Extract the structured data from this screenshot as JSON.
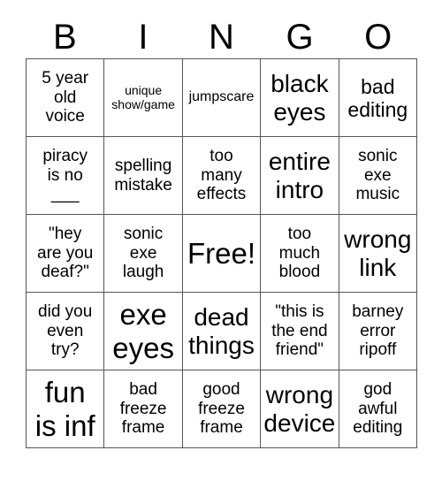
{
  "card": {
    "title": "BINGO",
    "headers": [
      "B",
      "I",
      "N",
      "G",
      "O"
    ],
    "free_space_label": "Free!",
    "colors": {
      "background": "#ffffff",
      "text": "#000000",
      "border": "#555555"
    },
    "rows": [
      [
        {
          "text": "5 year\nold\nvoice",
          "size": "m"
        },
        {
          "text": "unique\nshow/game",
          "size": "xs"
        },
        {
          "text": "jumpscare",
          "size": "s"
        },
        {
          "text": "black\neyes",
          "size": "xl"
        },
        {
          "text": "bad\nediting",
          "size": "l"
        }
      ],
      [
        {
          "text": "piracy\nis no\n___",
          "size": "m"
        },
        {
          "text": "spelling\nmistake",
          "size": "m"
        },
        {
          "text": "too\nmany\neffects",
          "size": "m"
        },
        {
          "text": "entire\nintro",
          "size": "xl"
        },
        {
          "text": "sonic\nexe\nmusic",
          "size": "m"
        }
      ],
      [
        {
          "text": "\"hey\nare you\ndeaf?\"",
          "size": "m"
        },
        {
          "text": "sonic\nexe\nlaugh",
          "size": "m"
        },
        {
          "text": "Free!",
          "size": "xxl"
        },
        {
          "text": "too\nmuch\nblood",
          "size": "m"
        },
        {
          "text": "wrong\nlink",
          "size": "xl"
        }
      ],
      [
        {
          "text": "did you\neven\ntry?",
          "size": "m"
        },
        {
          "text": "exe\neyes",
          "size": "xxl"
        },
        {
          "text": "dead\nthings",
          "size": "xl"
        },
        {
          "text": "\"this is\nthe end\nfriend\"",
          "size": "m"
        },
        {
          "text": "barney\nerror\nripoff",
          "size": "m"
        }
      ],
      [
        {
          "text": "fun\nis inf",
          "size": "xxl"
        },
        {
          "text": "bad\nfreeze\nframe",
          "size": "m"
        },
        {
          "text": "good\nfreeze\nframe",
          "size": "m"
        },
        {
          "text": "wrong\ndevice",
          "size": "xl"
        },
        {
          "text": "god\nawful\nediting",
          "size": "m"
        }
      ]
    ]
  }
}
